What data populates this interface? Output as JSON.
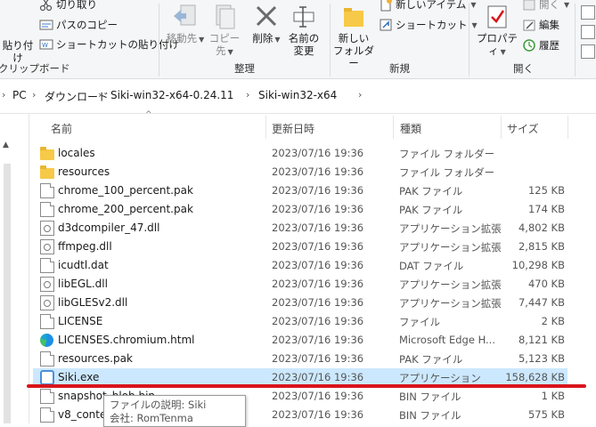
{
  "ribbon": {
    "clipboard": {
      "paste_label": "貼り付け",
      "cut_label": "切り取り",
      "copy_path_label": "パスのコピー",
      "paste_shortcut_label": "ショートカットの貼り付け",
      "group_label": "クリップボード"
    },
    "organize": {
      "move_to_label": "移動先",
      "copy_to_label": "コピー先",
      "delete_label": "削除",
      "rename_line1": "名前の",
      "rename_line2": "変更",
      "group_label": "整理"
    },
    "new": {
      "new_folder_line1": "新しい",
      "new_folder_line2": "フォルダー",
      "new_item_label": "新しいアイテム",
      "shortcut_label": "ショートカット",
      "group_label": "新規"
    },
    "open": {
      "properties_label": "プロパティ",
      "open_label": "開く",
      "edit_label": "編集",
      "history_label": "履歴",
      "group_label": "開く"
    }
  },
  "address": {
    "crumbs": [
      "PC",
      "ダウンロード",
      "Siki-win32-x64-0.24.11",
      "Siki-win32-x64"
    ]
  },
  "columns": {
    "name": "名前",
    "date": "更新日時",
    "type": "種類",
    "size": "サイズ"
  },
  "files": [
    {
      "name": "locales",
      "date": "2023/07/16 19:36",
      "type": "ファイル フォルダー",
      "size": "",
      "icon": "folder-icon"
    },
    {
      "name": "resources",
      "date": "2023/07/16 19:36",
      "type": "ファイル フォルダー",
      "size": "",
      "icon": "folder-icon"
    },
    {
      "name": "chrome_100_percent.pak",
      "date": "2023/07/16 19:36",
      "type": "PAK ファイル",
      "size": "125 KB",
      "icon": "file-icon"
    },
    {
      "name": "chrome_200_percent.pak",
      "date": "2023/07/16 19:36",
      "type": "PAK ファイル",
      "size": "174 KB",
      "icon": "file-icon"
    },
    {
      "name": "d3dcompiler_47.dll",
      "date": "2023/07/16 19:36",
      "type": "アプリケーション拡張",
      "size": "4,802 KB",
      "icon": "dll-icon"
    },
    {
      "name": "ffmpeg.dll",
      "date": "2023/07/16 19:36",
      "type": "アプリケーション拡張",
      "size": "2,815 KB",
      "icon": "dll-icon"
    },
    {
      "name": "icudtl.dat",
      "date": "2023/07/16 19:36",
      "type": "DAT ファイル",
      "size": "10,298 KB",
      "icon": "file-icon"
    },
    {
      "name": "libEGL.dll",
      "date": "2023/07/16 19:36",
      "type": "アプリケーション拡張",
      "size": "470 KB",
      "icon": "dll-icon"
    },
    {
      "name": "libGLESv2.dll",
      "date": "2023/07/16 19:36",
      "type": "アプリケーション拡張",
      "size": "7,447 KB",
      "icon": "dll-icon"
    },
    {
      "name": "LICENSE",
      "date": "2023/07/16 19:36",
      "type": "ファイル",
      "size": "2 KB",
      "icon": "file-icon"
    },
    {
      "name": "LICENSES.chromium.html",
      "date": "2023/07/16 19:36",
      "type": "Microsoft Edge H...",
      "size": "8,121 KB",
      "icon": "edge-icon"
    },
    {
      "name": "resources.pak",
      "date": "2023/07/16 19:36",
      "type": "PAK ファイル",
      "size": "5,123 KB",
      "icon": "file-icon"
    },
    {
      "name": "Siki.exe",
      "date": "2023/07/16 19:36",
      "type": "アプリケーション",
      "size": "158,628 KB",
      "icon": "app-icon",
      "selected": true
    },
    {
      "name": "snapshot_blob.bin",
      "date": "2023/07/16 19:36",
      "type": "BIN ファイル",
      "size": "1 KB",
      "icon": "file-icon"
    },
    {
      "name": "v8_context_snapshot.bin",
      "date": "2023/07/16 19:36",
      "type": "BIN ファイル",
      "size": "575 KB",
      "icon": "file-icon"
    }
  ],
  "tooltip": {
    "line1": "ファイルの説明: Siki",
    "line2": "会社: RomTenma"
  },
  "colors": {
    "selection": "#cce8ff",
    "annotation_red": "#d9151c"
  }
}
